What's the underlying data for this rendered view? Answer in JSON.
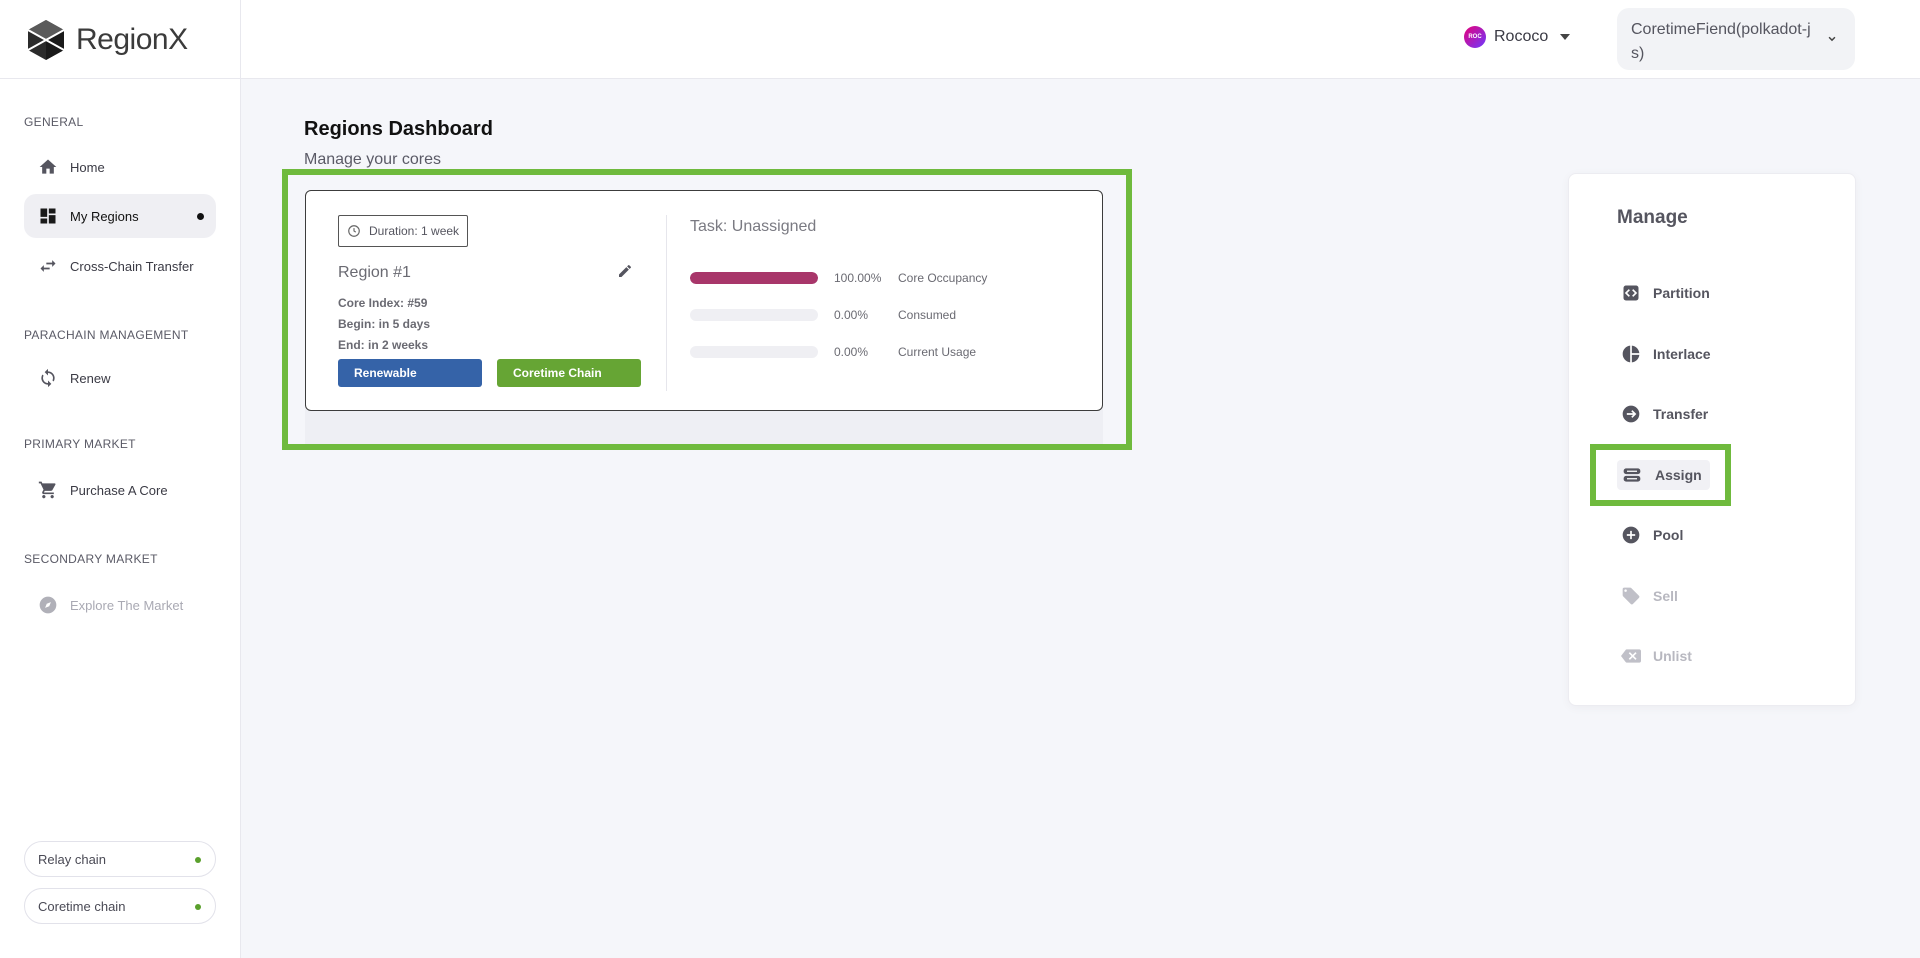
{
  "app": {
    "logo_text": "RegionX"
  },
  "header": {
    "network": {
      "label": "Rococo",
      "icon_text": "ROC"
    },
    "account": {
      "label": "CoretimeFiend(polkadot-js)"
    }
  },
  "sidebar": {
    "sections": [
      {
        "title": "GENERAL"
      },
      {
        "title": "PARACHAIN MANAGEMENT"
      },
      {
        "title": "PRIMARY MARKET"
      },
      {
        "title": "SECONDARY MARKET"
      }
    ],
    "items": [
      {
        "label": "Home",
        "icon": "home-icon"
      },
      {
        "label": "My Regions",
        "icon": "dashboard-icon",
        "active": true
      },
      {
        "label": "Cross-Chain Transfer",
        "icon": "swap-icon"
      },
      {
        "label": "Renew",
        "icon": "renew-icon"
      },
      {
        "label": "Purchase A Core",
        "icon": "cart-icon"
      },
      {
        "label": "Explore The Market",
        "icon": "compass-icon",
        "disabled": true
      }
    ],
    "chains": [
      {
        "label": "Relay chain",
        "status_color": "#5aa02c"
      },
      {
        "label": "Coretime chain",
        "status_color": "#5aa02c"
      }
    ]
  },
  "main": {
    "title": "Regions Dashboard",
    "subtitle": "Manage your cores",
    "region": {
      "duration": "Duration: 1 week",
      "name": "Region #1",
      "core_index": "Core Index: #59",
      "begin": "Begin: in 5 days",
      "end": "End: in 2 weeks",
      "tags": [
        "Renewable",
        "Coretime Chain"
      ],
      "task": "Task: Unassigned",
      "metrics": [
        {
          "label": "Core Occupancy",
          "value_text": "100.00%",
          "value": 1.0
        },
        {
          "label": "Consumed",
          "value_text": "0.00%",
          "value": 0.0
        },
        {
          "label": "Current Usage",
          "value_text": "0.00%",
          "value": 0.0
        }
      ]
    }
  },
  "manage": {
    "title": "Manage",
    "items": [
      {
        "label": "Partition",
        "icon": "partition-icon"
      },
      {
        "label": "Interlace",
        "icon": "pie-icon"
      },
      {
        "label": "Transfer",
        "icon": "arrow-right-icon"
      },
      {
        "label": "Assign",
        "icon": "assign-icon",
        "selected": true
      },
      {
        "label": "Pool",
        "icon": "plus-circle-icon"
      },
      {
        "label": "Sell",
        "icon": "tag-icon",
        "disabled": true
      },
      {
        "label": "Unlist",
        "icon": "backspace-icon",
        "disabled": true
      }
    ]
  },
  "colors": {
    "accent_green": "#6fba3d",
    "tag_blue": "#3563a8",
    "tag_green": "#66a534",
    "occupancy_bar": "#a8366a"
  }
}
